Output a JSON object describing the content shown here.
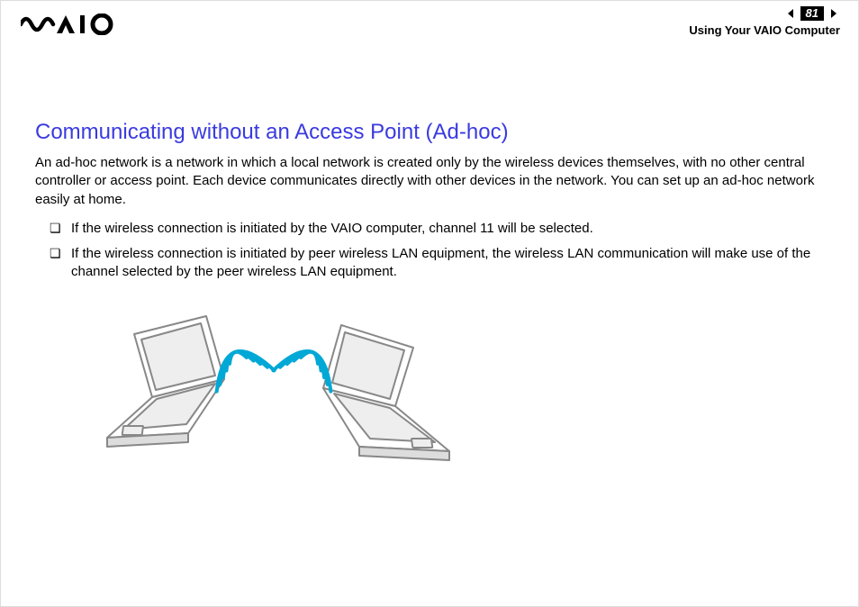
{
  "header": {
    "page_number": "81",
    "section": "Using Your VAIO Computer"
  },
  "content": {
    "heading": "Communicating without an Access Point (Ad-hoc)",
    "intro": "An ad-hoc network is a network in which a local network is created only by the wireless devices themselves, with no other central controller or access point. Each device communicates directly with other devices in the network. You can set up an ad-hoc network easily at home.",
    "bullets": [
      "If the wireless connection is initiated by the VAIO computer, channel 11 will be selected.",
      "If the wireless connection is initiated by peer wireless LAN equipment, the wireless LAN communication will make use of the channel selected by the peer wireless LAN equipment."
    ]
  }
}
